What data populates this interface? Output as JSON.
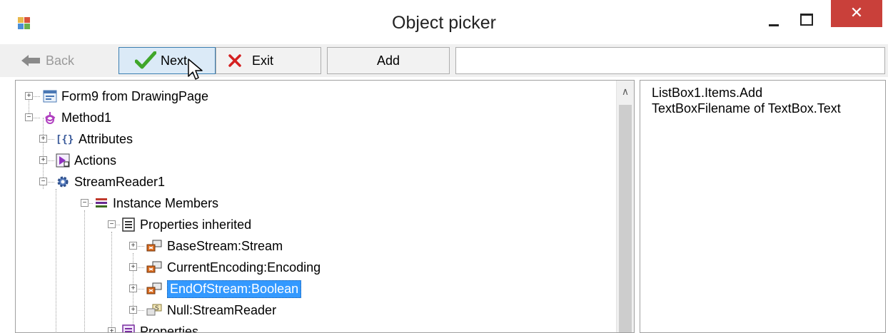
{
  "window": {
    "title": "Object picker",
    "close_glyph": "✕",
    "accent_close": "#c9403a"
  },
  "toolbar": {
    "back_label": "Back",
    "next_label": "Next",
    "exit_label": "Exit",
    "add_label": "Add",
    "search_value": ""
  },
  "tree": {
    "nodes": [
      {
        "label": "Form9 from DrawingPage",
        "icon": "form-icon",
        "expanded": false
      },
      {
        "label": "Method1",
        "icon": "method-icon",
        "expanded": true
      },
      {
        "label": "Attributes",
        "icon": "attributes-icon",
        "expanded": false
      },
      {
        "label": "Actions",
        "icon": "actions-icon",
        "expanded": false
      },
      {
        "label": "StreamReader1",
        "icon": "gear-icon",
        "expanded": true
      },
      {
        "label": "Instance Members",
        "icon": "members-icon",
        "expanded": true
      },
      {
        "label": "Properties inherited",
        "icon": "properties-icon",
        "expanded": true
      },
      {
        "label": "BaseStream:Stream",
        "icon": "property-icon",
        "expanded": false
      },
      {
        "label": "CurrentEncoding:Encoding",
        "icon": "property-icon",
        "expanded": false
      },
      {
        "label": "EndOfStream:Boolean",
        "icon": "property-icon",
        "expanded": false,
        "selected": true
      },
      {
        "label": "Null:StreamReader",
        "icon": "static-property-icon",
        "expanded": false
      },
      {
        "label": "Properties",
        "icon": "properties-icon",
        "expanded": false
      }
    ]
  },
  "actions_list": {
    "items": [
      "ListBox1.Items.Add",
      "TextBoxFilename of TextBox.Text"
    ]
  },
  "colors": {
    "selection": "#3399ff",
    "next_button_bg": "#dbeaf7",
    "next_check": "#3fa62a",
    "exit_x": "#d42020"
  }
}
